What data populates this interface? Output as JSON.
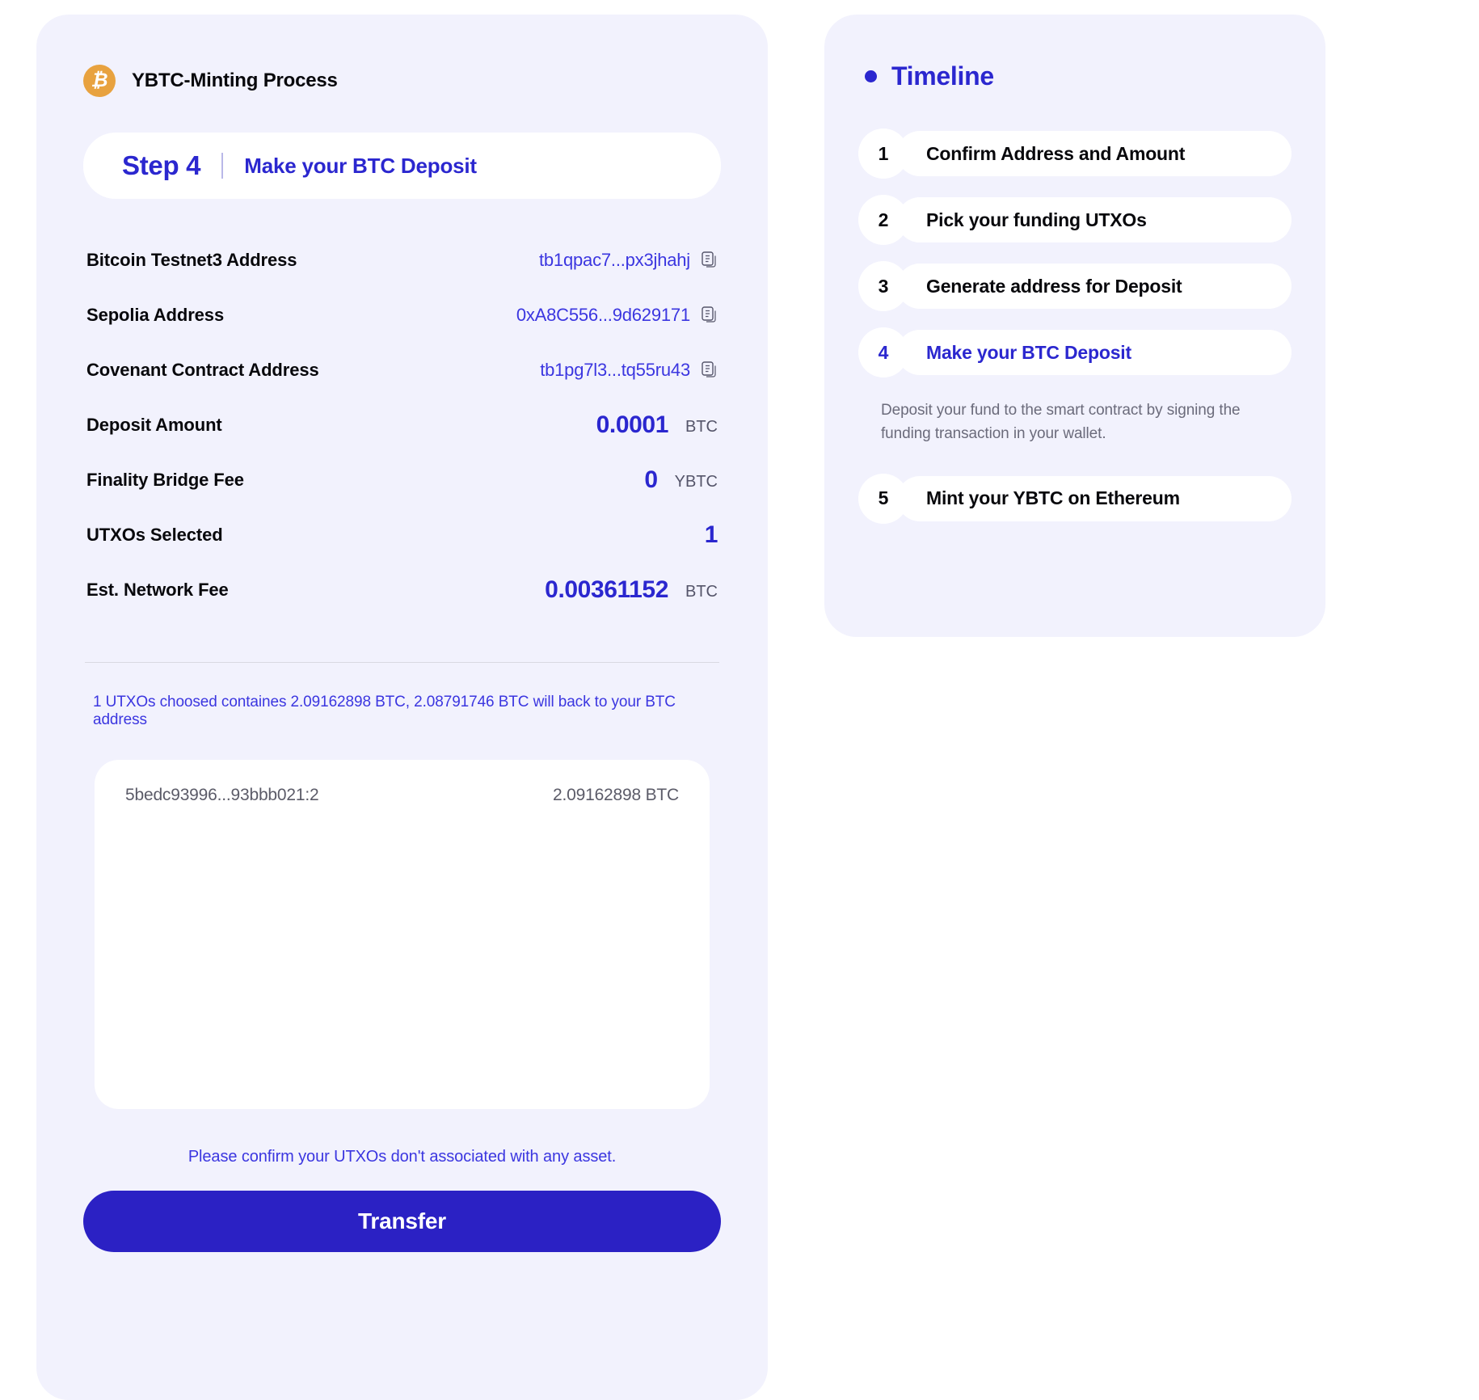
{
  "mint": {
    "header_title": "YBTC-Minting Process",
    "btc_icon": "bitcoin-icon",
    "step_number": "Step 4",
    "step_title": "Make your BTC Deposit",
    "rows": [
      {
        "label": "Bitcoin Testnet3 Address",
        "value": "tb1qpac7...px3jhahj",
        "unit": "",
        "type": "address"
      },
      {
        "label": "Sepolia Address",
        "value": "0xA8C556...9d629171",
        "unit": "",
        "type": "address"
      },
      {
        "label": "Covenant Contract Address",
        "value": "tb1pg7l3...tq55ru43",
        "unit": "",
        "type": "address"
      },
      {
        "label": "Deposit Amount",
        "value": "0.0001",
        "unit": "BTC",
        "type": "amount"
      },
      {
        "label": "Finality Bridge Fee",
        "value": "0",
        "unit": "YBTC",
        "type": "amount"
      },
      {
        "label": "UTXOs Selected",
        "value": "1",
        "unit": "",
        "type": "amount"
      },
      {
        "label": "Est. Network Fee",
        "value": "0.00361152",
        "unit": "BTC",
        "type": "amount"
      }
    ],
    "utxo_summary": "1 UTXOs choosed containes 2.09162898 BTC, 2.08791746 BTC will back to your BTC address",
    "utxo_list": [
      {
        "id": "5bedc93996...93bbb021:2",
        "amount": "2.09162898 BTC"
      }
    ],
    "confirm_note": "Please confirm your UTXOs don't associated with any asset.",
    "transfer_label": "Transfer"
  },
  "timeline": {
    "title": "Timeline",
    "items": [
      {
        "num": "1",
        "label": "Confirm Address and Amount",
        "active": false,
        "desc": ""
      },
      {
        "num": "2",
        "label": "Pick your funding UTXOs",
        "active": false,
        "desc": ""
      },
      {
        "num": "3",
        "label": "Generate address for Deposit",
        "active": false,
        "desc": ""
      },
      {
        "num": "4",
        "label": "Make your BTC Deposit",
        "active": true,
        "desc": "Deposit your fund to the smart contract by signing the funding transaction in your wallet."
      },
      {
        "num": "5",
        "label": "Mint your YBTC on Ethereum",
        "active": false,
        "desc": ""
      }
    ]
  },
  "colors": {
    "accent": "#2b27cf",
    "button": "#2b21c4",
    "panel_bg": "#f2f2fd",
    "bitcoin": "#e8a23f",
    "muted": "#6b6b7b"
  }
}
